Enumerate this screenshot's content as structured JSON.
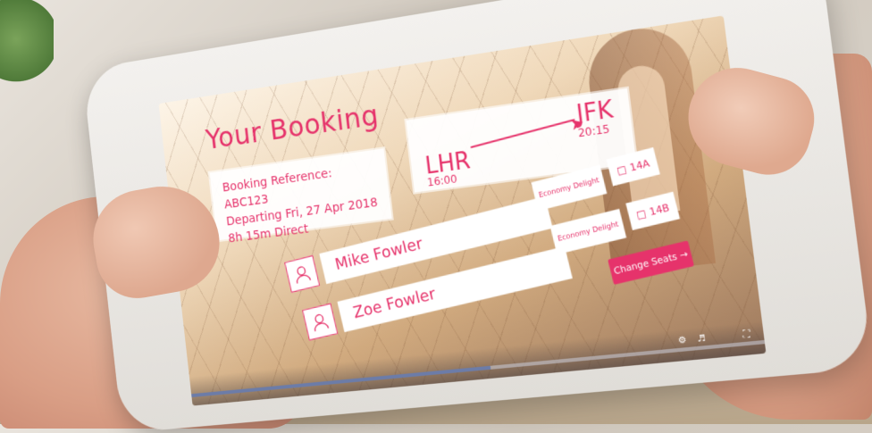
{
  "booking": {
    "title": "Your Booking",
    "reference_line": "Booking Reference: ABC123",
    "departing_line": "Departing Fri, 27 Apr 2018",
    "duration_line": "8h 15m Direct"
  },
  "route": {
    "origin": "LHR",
    "origin_time": "16:00",
    "destination": "JFK",
    "destination_time": "20:15"
  },
  "passengers": [
    {
      "name": "Mike Fowler",
      "class": "Economy Delight",
      "seat": "14A"
    },
    {
      "name": "Zoe Fowler",
      "class": "Economy Delight",
      "seat": "14B"
    }
  ],
  "actions": {
    "change_seats": "Change Seats →"
  },
  "colors": {
    "accent": "#e6336b"
  },
  "icons": {
    "avatar": "user-icon",
    "seat": "seat-icon"
  }
}
